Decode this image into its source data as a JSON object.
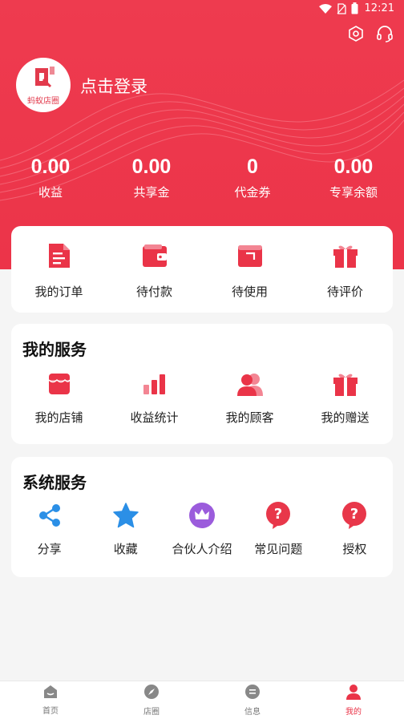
{
  "status_bar": {
    "time": "12:21"
  },
  "header": {
    "avatar_text": "蚂蚁店圈",
    "login_text": "点击登录"
  },
  "stats": [
    {
      "value": "0.00",
      "label": "收益"
    },
    {
      "value": "0.00",
      "label": "共享金"
    },
    {
      "value": "0",
      "label": "代金券"
    },
    {
      "value": "0.00",
      "label": "专享余额"
    }
  ],
  "orders": [
    {
      "label": "我的订单",
      "icon": "order-document-icon"
    },
    {
      "label": "待付款",
      "icon": "wallet-icon"
    },
    {
      "label": "待使用",
      "icon": "voucher-icon"
    },
    {
      "label": "待评价",
      "icon": "gift-box-icon"
    }
  ],
  "my_services": {
    "title": "我的服务",
    "items": [
      {
        "label": "我的店铺",
        "icon": "shop-icon"
      },
      {
        "label": "收益统计",
        "icon": "bar-chart-icon"
      },
      {
        "label": "我的顾客",
        "icon": "customers-icon"
      },
      {
        "label": "我的赠送",
        "icon": "gift-icon"
      }
    ]
  },
  "system_services": {
    "title": "系统服务",
    "items": [
      {
        "label": "分享",
        "icon": "share-icon"
      },
      {
        "label": "收藏",
        "icon": "star-icon"
      },
      {
        "label": "合伙人介绍",
        "icon": "crown-icon"
      },
      {
        "label": "常见问题",
        "icon": "question-icon"
      },
      {
        "label": "授权",
        "icon": "authorize-question-icon"
      }
    ]
  },
  "tabbar": [
    {
      "label": "首页",
      "icon": "home-icon"
    },
    {
      "label": "店圈",
      "icon": "compass-icon"
    },
    {
      "label": "信息",
      "icon": "message-icon"
    },
    {
      "label": "我的",
      "icon": "user-icon",
      "active": true
    }
  ],
  "colors": {
    "brand": "#ea3448",
    "background": "#f5f5f5"
  }
}
